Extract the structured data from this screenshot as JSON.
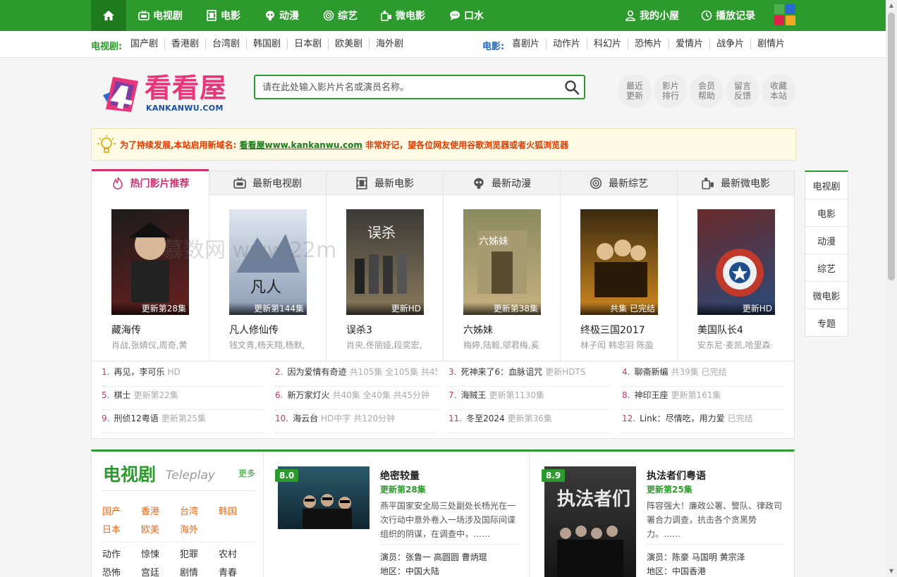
{
  "topnav": {
    "items": [
      {
        "label": "电视剧",
        "icon": "tv-icon"
      },
      {
        "label": "电影",
        "icon": "film-icon"
      },
      {
        "label": "动漫",
        "icon": "alien-icon"
      },
      {
        "label": "综艺",
        "icon": "target-icon"
      },
      {
        "label": "微电影",
        "icon": "camera-icon"
      },
      {
        "label": "口水",
        "icon": "chat-icon"
      }
    ],
    "right_items": [
      {
        "label": "我的小屋",
        "icon": "user-icon"
      },
      {
        "label": "播放记录",
        "icon": "clock-icon"
      }
    ]
  },
  "subnav": {
    "tv_label": "电视剧:",
    "tv_links": [
      "国产剧",
      "香港剧",
      "台湾剧",
      "韩国剧",
      "日本剧",
      "欧美剧",
      "海外剧"
    ],
    "movie_label": "电影:",
    "movie_links": [
      "喜剧片",
      "动作片",
      "科幻片",
      "恐怖片",
      "爱情片",
      "战争片",
      "剧情片"
    ]
  },
  "brand": {
    "title": "看看屋",
    "domain": "KANKANWU.COM"
  },
  "search": {
    "placeholder": "请在此处输入影片片名或演员名称。"
  },
  "quick_links": [
    {
      "l1": "最近",
      "l2": "更新"
    },
    {
      "l1": "影片",
      "l2": "排行"
    },
    {
      "l1": "会员",
      "l2": "帮助"
    },
    {
      "l1": "留言",
      "l2": "反馈"
    },
    {
      "l1": "收藏",
      "l2": "本站"
    }
  ],
  "notice": {
    "prefix": "为了持续发展,本站启用新域名:",
    "link": "看看屋www.kankanwu.com",
    "suffix": " 非常好记，望各位网友使用谷歌浏览器或者火狐浏览器"
  },
  "tabs": [
    "热门影片推荐",
    "最新电视剧",
    "最新电影",
    "最新动漫",
    "最新综艺",
    "最新微电影"
  ],
  "posters": [
    {
      "name": "藏海传",
      "cast": "肖战,张婧仪,周奇,黄",
      "badge": "更新第28集",
      "colors": [
        "#1b1b1b",
        "#6b2020"
      ]
    },
    {
      "name": "凡人修仙传",
      "cast": "钱文青,杨天翔,杨默,",
      "badge": "更新第144集",
      "colors": [
        "#c7d3e3",
        "#7a8ca6"
      ]
    },
    {
      "name": "误杀3",
      "cast": "肖央,佟丽娅,段奕宏,",
      "badge": "更新HD",
      "colors": [
        "#3b3a36",
        "#8a7a5c"
      ]
    },
    {
      "name": "六姊妹",
      "cast": "梅婷,陆毅,邬君梅,奚",
      "badge": "更新第38集",
      "colors": [
        "#8a8a60",
        "#c9b280"
      ]
    },
    {
      "name": "终极三国2017",
      "cast": "林子闳 韩忠羽 陈盈",
      "badge": "共集 已完结",
      "colors": [
        "#3a2a10",
        "#d08a20"
      ]
    },
    {
      "name": "美国队长4",
      "cast": "安东尼·麦凯,哈里森·",
      "badge": "更新HD",
      "colors": [
        "#6a2a2a",
        "#2a4a7a"
      ]
    }
  ],
  "ranking": [
    {
      "n": "1.",
      "t": "再见，李可乐",
      "m": "HD"
    },
    {
      "n": "2.",
      "t": "因为爱情有奇迹",
      "m": "共105集 全105集 共45"
    },
    {
      "n": "3.",
      "t": "死神来了6：血脉诅咒",
      "m": "更新HDTS"
    },
    {
      "n": "4.",
      "t": "聊斋新编",
      "m": "共39集 已完结"
    },
    {
      "n": "5.",
      "t": "棋士",
      "m": "更新第22集"
    },
    {
      "n": "6.",
      "t": "新万家灯火",
      "m": "共40集 全40集 共45分钟"
    },
    {
      "n": "7.",
      "t": "海贼王",
      "m": "更新第1130集"
    },
    {
      "n": "8.",
      "t": "神印王座",
      "m": "更新第161集"
    },
    {
      "n": "9.",
      "t": "刑侦12粤语",
      "m": "更新第25集"
    },
    {
      "n": "10.",
      "t": "海云台",
      "m": "HD中字 共120分钟"
    },
    {
      "n": "11.",
      "t": "冬至2024",
      "m": "更新第36集"
    },
    {
      "n": "12.",
      "t": "Link：尽情吃，用力爱",
      "m": "已完结"
    }
  ],
  "side_tabs": [
    "电视剧",
    "电影",
    "动漫",
    "综艺",
    "微电影",
    "专题"
  ],
  "tv_section": {
    "title": "电视剧",
    "subtitle": "Teleplay",
    "more": "更多",
    "regions": [
      "国产",
      "香港",
      "台湾",
      "韩国",
      "日本",
      "欧美",
      "海外"
    ],
    "genres": [
      "动作",
      "惊悚",
      "犯罪",
      "农村",
      "恐怖",
      "宫廷",
      "剧情",
      "青春"
    ],
    "featured": [
      {
        "score": "8.0",
        "title": "绝密较量",
        "status": "更新第28集",
        "desc": "燕平国家安全局三处副处长杨光在一次行动中意外卷入一场涉及国际间谍组织的阴谋，在调查中，……",
        "actors_label": "演员：",
        "actors": "张鲁一  高圆圆  曹炳琨",
        "region_label": "地区：",
        "region": "中国大陆"
      },
      {
        "score": "8.9",
        "title": "执法者们粤语",
        "status": "更新第25集",
        "desc": "阵容强大！廉政公署、警队、律政司署合力调查，抗击各个贪黑势力。……",
        "actors_label": "演员：",
        "actors": "陈豪  马国明  黄宗泽",
        "region_label": "地区：",
        "region": "中国香港"
      }
    ]
  },
  "watermark": "慕数网 www.22m"
}
